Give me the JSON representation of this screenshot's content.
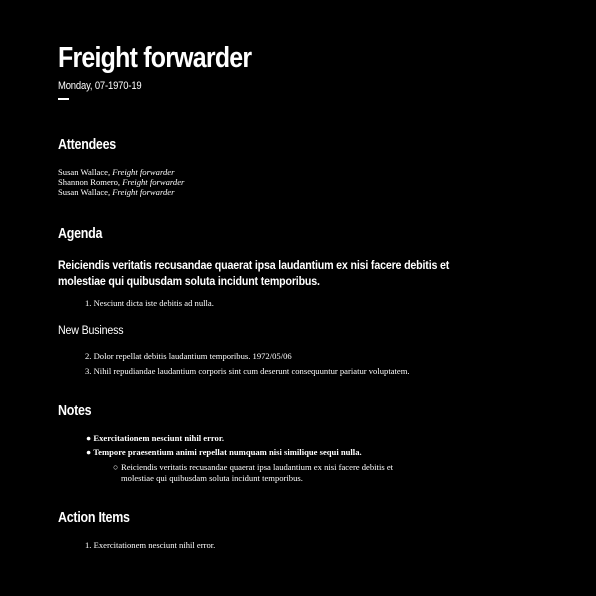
{
  "header": {
    "title": "Freight forwarder",
    "date": "Monday, 07-1970-19"
  },
  "attendees": {
    "heading": "Attendees",
    "people": [
      {
        "name": "Susan Wallace, ",
        "role": "Freight forwarder"
      },
      {
        "name": "Shannon Romero, ",
        "role": "Freight forwarder"
      },
      {
        "name": "Susan Wallace, ",
        "role": "Freight forwarder"
      }
    ]
  },
  "agenda": {
    "heading": "Agenda",
    "lead_line_1": "Reiciendis veritatis recusandae quaerat ipsa laudantium ex nisi facere debitis et",
    "lead_line_2": "molestiae qui quibusdam soluta incidunt temporibus.",
    "items": [
      "1. Nesciunt dicta iste debitis ad nulla."
    ],
    "new_business_heading": "New Business",
    "new_business_items": [
      "2. Dolor repellat debitis laudantium temporibus. 1972/05/06",
      "3. Nihil repudiandae laudantium corporis sint cum deserunt consequuntur pariatur voluptatem."
    ]
  },
  "notes": {
    "heading": "Notes",
    "bullets": [
      "Exercitationem nesciunt nihil error.",
      "Tempore praesentium animi repellat numquam nisi similique sequi nulla."
    ],
    "bullet_marker": "●",
    "sub_marker": "○",
    "sub_bullet_line_1": "Reiciendis veritatis recusandae quaerat ipsa laudantium ex nisi facere debitis et",
    "sub_bullet_line_2": "molestiae qui quibusdam soluta incidunt temporibus."
  },
  "action_items": {
    "heading": "Action Items",
    "items": [
      "1. Exercitationem nesciunt nihil error."
    ]
  }
}
